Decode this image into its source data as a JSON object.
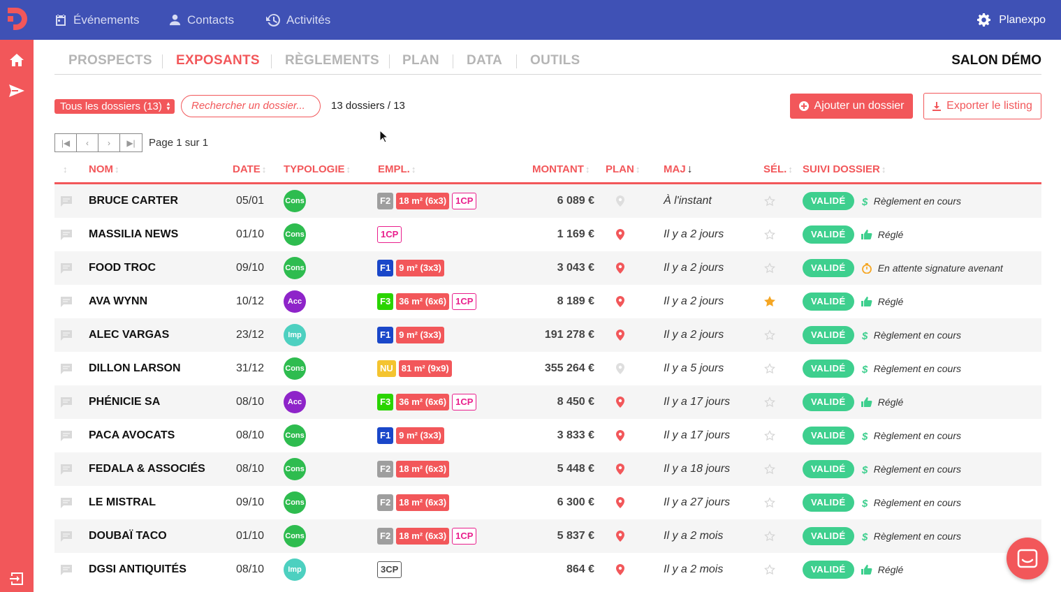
{
  "topbar": {
    "nav": [
      {
        "label": "Événements",
        "icon": "calendar-icon"
      },
      {
        "label": "Contacts",
        "icon": "person-icon"
      },
      {
        "label": "Activités",
        "icon": "history-icon"
      }
    ],
    "account": "Planexpo"
  },
  "tabs": [
    {
      "label": "PROSPECTS",
      "active": false
    },
    {
      "label": "EXPOSANTS",
      "active": true
    },
    {
      "label": "RÈGLEMENTS",
      "active": false
    },
    {
      "label": "PLAN",
      "active": false
    },
    {
      "label": "DATA",
      "active": false
    },
    {
      "label": "OUTILS",
      "active": false
    }
  ],
  "event_name": "SALON DÉMO",
  "toolbar": {
    "filter": "Tous les dossiers (13)",
    "search_placeholder": "Rechercher un dossier...",
    "count": "13 dossiers / 13",
    "add_label": "Ajouter un dossier",
    "export_label": "Exporter le listing"
  },
  "pagination": {
    "label": "Page 1 sur 1"
  },
  "columns": {
    "nom": "NOM",
    "date": "DATE",
    "typologie": "TYPOLOGIE",
    "empl": "EMPL.",
    "montant": "MONTANT",
    "plan": "PLAN",
    "maj": "MAJ",
    "sel": "SÉL.",
    "suivi": "SUIVI DOSSIER"
  },
  "colors": {
    "brand_red": "#f2575a",
    "nav_blue": "#3f51b5",
    "valid_green": "#3ecf8e",
    "cons": "#2ebc4f",
    "acc": "#8e24c9",
    "imp": "#4dd0c0",
    "F1": "#1a47c9",
    "F2": "#9e9e9e",
    "F3": "#2ad400",
    "NU": "#f4c430"
  },
  "rows": [
    {
      "nom": "BRUCE CARTER",
      "date": "05/01",
      "typo": "Cons",
      "sector": "F2",
      "surface": "18 m² (6x3)",
      "cp": "1CP",
      "montant": "6 089 €",
      "plan": false,
      "maj": "À l'instant",
      "sel": false,
      "statut": "VALIDÉ",
      "suivi": "Règlement en cours",
      "suivi_icon": "dollar"
    },
    {
      "nom": "MASSILIA NEWS",
      "date": "01/10",
      "typo": "Cons",
      "sector": "",
      "surface": "",
      "cp": "1CP",
      "montant": "1 169 €",
      "plan": true,
      "maj": "Il y a 2 jours",
      "sel": false,
      "statut": "VALIDÉ",
      "suivi": "Réglé",
      "suivi_icon": "thumb"
    },
    {
      "nom": "FOOD TROC",
      "date": "09/10",
      "typo": "Cons",
      "sector": "F1",
      "surface": "9 m² (3x3)",
      "cp": "",
      "montant": "3 043 €",
      "plan": true,
      "maj": "Il y a 2 jours",
      "sel": false,
      "statut": "VALIDÉ",
      "suivi": "En attente signature avenant",
      "suivi_icon": "timer"
    },
    {
      "nom": "AVA WYNN",
      "date": "10/12",
      "typo": "Acc",
      "sector": "F3",
      "surface": "36 m² (6x6)",
      "cp": "1CP",
      "montant": "8 189 €",
      "plan": true,
      "maj": "Il y a 2 jours",
      "sel": true,
      "statut": "VALIDÉ",
      "suivi": "Réglé",
      "suivi_icon": "thumb"
    },
    {
      "nom": "ALEC VARGAS",
      "date": "23/12",
      "typo": "Imp",
      "sector": "F1",
      "surface": "9 m² (3x3)",
      "cp": "",
      "montant": "191 278 €",
      "plan": true,
      "maj": "Il y a 2 jours",
      "sel": false,
      "statut": "VALIDÉ",
      "suivi": "Règlement en cours",
      "suivi_icon": "dollar"
    },
    {
      "nom": "DILLON LARSON",
      "date": "31/12",
      "typo": "Cons",
      "sector": "NU",
      "surface": "81 m² (9x9)",
      "cp": "",
      "montant": "355 264 €",
      "plan": false,
      "maj": "Il y a 5 jours",
      "sel": false,
      "statut": "VALIDÉ",
      "suivi": "Règlement en cours",
      "suivi_icon": "dollar"
    },
    {
      "nom": "PHÉNICIE SA",
      "date": "08/10",
      "typo": "Acc",
      "sector": "F3",
      "surface": "36 m² (6x6)",
      "cp": "1CP",
      "montant": "8 450 €",
      "plan": true,
      "maj": "Il y a 17 jours",
      "sel": false,
      "statut": "VALIDÉ",
      "suivi": "Réglé",
      "suivi_icon": "thumb"
    },
    {
      "nom": "PACA AVOCATS",
      "date": "08/10",
      "typo": "Cons",
      "sector": "F1",
      "surface": "9 m² (3x3)",
      "cp": "",
      "montant": "3 833 €",
      "plan": true,
      "maj": "Il y a 17 jours",
      "sel": false,
      "statut": "VALIDÉ",
      "suivi": "Règlement en cours",
      "suivi_icon": "dollar"
    },
    {
      "nom": "FEDALA & ASSOCIÉS",
      "date": "08/10",
      "typo": "Cons",
      "sector": "F2",
      "surface": "18 m² (6x3)",
      "cp": "",
      "montant": "5 448 €",
      "plan": true,
      "maj": "Il y a 18 jours",
      "sel": false,
      "statut": "VALIDÉ",
      "suivi": "Règlement en cours",
      "suivi_icon": "dollar"
    },
    {
      "nom": "LE MISTRAL",
      "date": "09/10",
      "typo": "Cons",
      "sector": "F2",
      "surface": "18 m² (6x3)",
      "cp": "",
      "montant": "6 300 €",
      "plan": true,
      "maj": "Il y a 27 jours",
      "sel": false,
      "statut": "VALIDÉ",
      "suivi": "Règlement en cours",
      "suivi_icon": "dollar"
    },
    {
      "nom": "DOUBAÏ TACO",
      "date": "01/10",
      "typo": "Cons",
      "sector": "F2",
      "surface": "18 m² (6x3)",
      "cp": "1CP",
      "montant": "5 837 €",
      "plan": true,
      "maj": "Il y a 2 mois",
      "sel": false,
      "statut": "VALIDÉ",
      "suivi": "Règlement en cours",
      "suivi_icon": "dollar"
    },
    {
      "nom": "DGSI ANTIQUITÉS",
      "date": "08/10",
      "typo": "Imp",
      "sector": "",
      "surface": "",
      "cp": "3CP",
      "montant": "864 €",
      "plan": true,
      "maj": "Il y a 2 mois",
      "sel": false,
      "statut": "VALIDÉ",
      "suivi": "Réglé",
      "suivi_icon": "thumb"
    }
  ]
}
